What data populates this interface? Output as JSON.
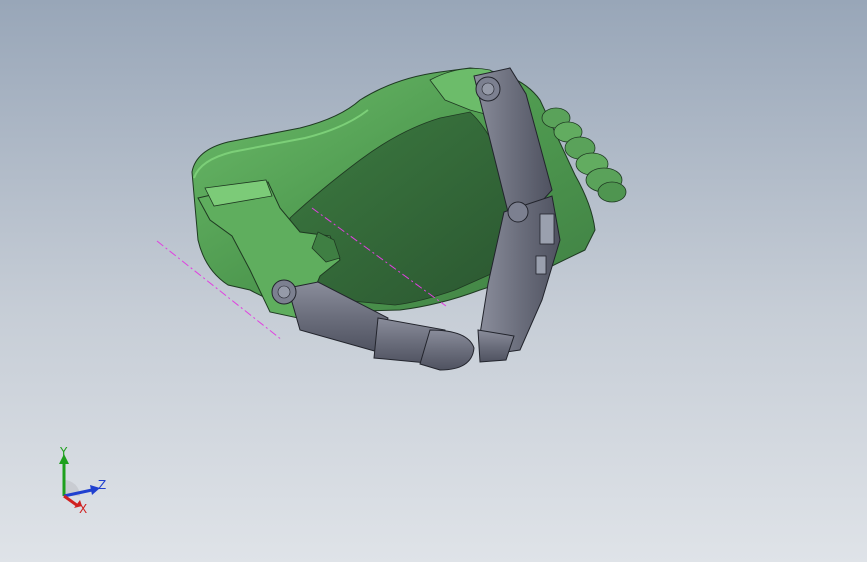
{
  "viewport": {
    "background_top": "#98a6b8",
    "background_bottom": "#dfe3e8"
  },
  "model": {
    "palm_color": "#5aa25a",
    "palm_shadow_color": "#2f5c33",
    "finger_color": "#6e717f",
    "centerline_color": "#e040e0"
  },
  "triad": {
    "x_label": "X",
    "y_label": "Y",
    "z_label": "Z",
    "x_color": "#d02020",
    "y_color": "#1ea01e",
    "z_color": "#2040d0"
  }
}
